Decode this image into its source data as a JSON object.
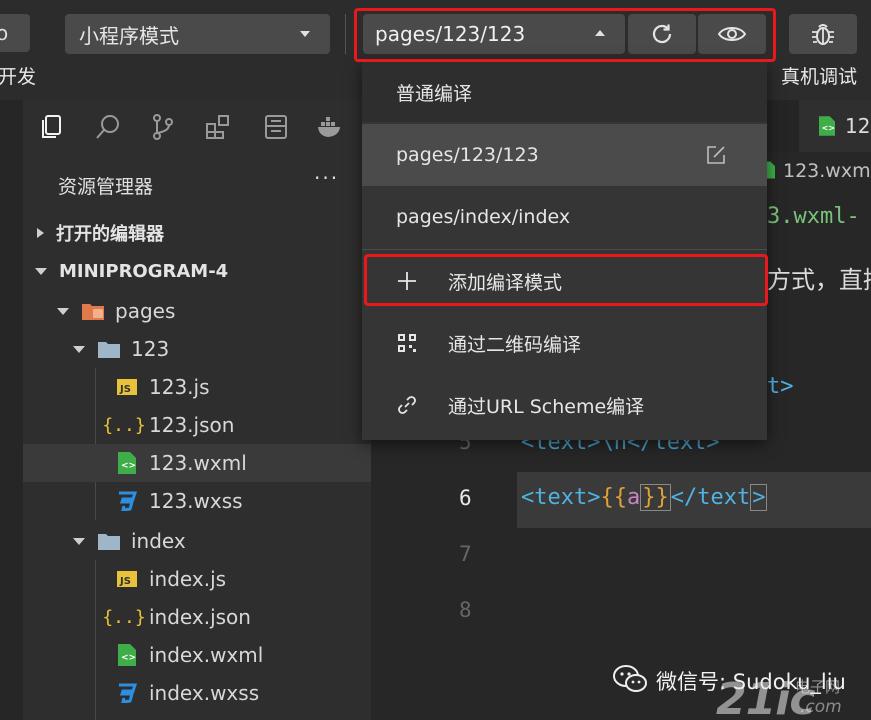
{
  "toolbar": {
    "left_stub_label": "o",
    "mode_select_value": "小程序模式",
    "page_select_value": "pages/123/123",
    "dev_label": "开发",
    "real_debug_label": "真机调试"
  },
  "explorer": {
    "title": "资源管理器",
    "more": "···",
    "open_editors": "打开的编辑器",
    "project": "MINIPROGRAM-4",
    "tree": {
      "pages": "pages",
      "folder_123": "123",
      "f123_js": "123.js",
      "f123_json": "123.json",
      "f123_wxml": "123.wxml",
      "f123_wxss": "123.wxss",
      "folder_index": "index",
      "index_js": "index.js",
      "index_json": "index.json",
      "index_wxml": "index.wxml",
      "index_wxss": "index.wxss"
    }
  },
  "editor": {
    "tab_label": "12",
    "breadcrumb": "123.wxm",
    "frag_title": "3.wxml-",
    "frag_text": "方式，直接",
    "frag_line4": "t>",
    "frag_line5": "<text>\\n</text>",
    "line_numbers": {
      "l5": "5",
      "l6": "6",
      "l7": "7",
      "l8": "8"
    },
    "line6": {
      "open_tag": "<text>",
      "open_brace": "{{",
      "expr": "a",
      "close_brace": "}}",
      "close_tag_start": "<",
      "close_tag_rest": "/text",
      "close_tag_end": ">"
    }
  },
  "dropdown": {
    "header": "普通编译",
    "items": [
      {
        "label": "pages/123/123"
      },
      {
        "label": "pages/index/index"
      },
      {
        "label": "添加编译模式"
      },
      {
        "label": "通过二维码编译"
      },
      {
        "label": "通过URL Scheme编译"
      }
    ]
  },
  "watermark": {
    "text": "微信号: Sudoku_liu",
    "logo": "21ic",
    "logo_sub": "电子网",
    "logo_com": ".com"
  },
  "colors": {
    "highlight_frame": "#e8181b",
    "tag_blue": "#4fb2e2",
    "brace_gold": "#e0a236",
    "expr_purple": "#c586c0",
    "wxml_green": "#3fae49",
    "js_yellow": "#e8c23a",
    "wxss_blue": "#2c8fe0",
    "folder_orange": "#e07a4a"
  }
}
